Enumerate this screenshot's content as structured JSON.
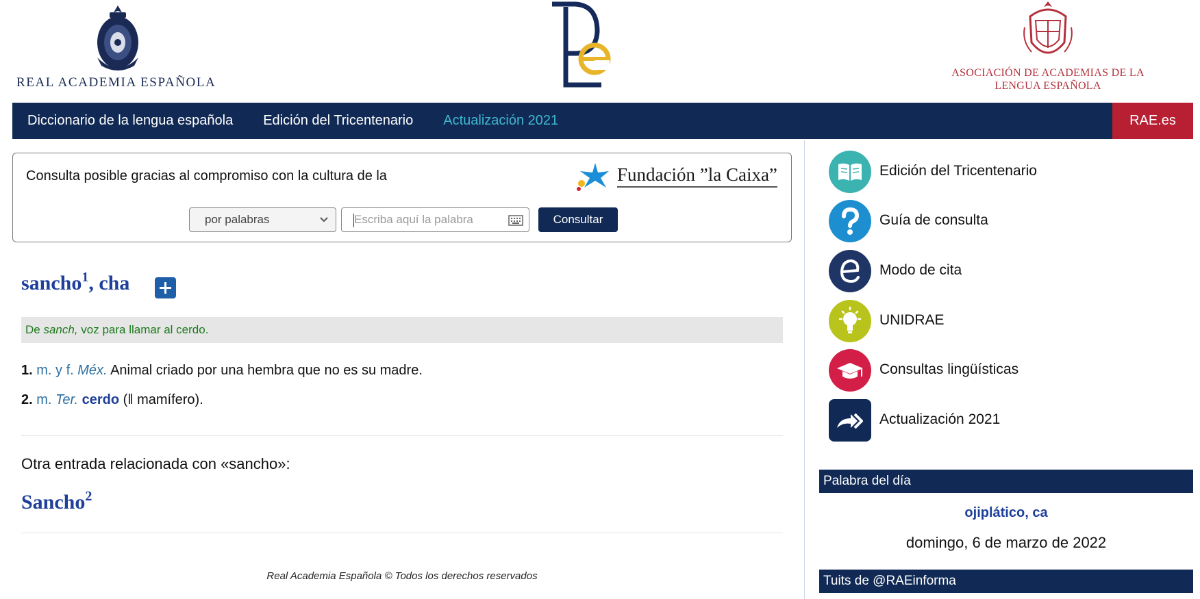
{
  "header": {
    "rae_name": "REAL ACADEMIA ESPAÑOLA",
    "asale_name_line1": "ASOCIACIÓN DE ACADEMIAS DE LA",
    "asale_name_line2": "LENGUA ESPAÑOLA"
  },
  "nav": {
    "items": [
      {
        "label": "Diccionario de la lengua española"
      },
      {
        "label": "Edición del Tricentenario"
      },
      {
        "label": "Actualización 2021"
      }
    ],
    "rae_link": "RAE.es"
  },
  "search": {
    "sponsor_text": "Consulta posible gracias al compromiso con la cultura de la",
    "sponsor_name": "Fundación ”la Caixa”",
    "mode": "por palabras",
    "placeholder": "Escriba aquí la palabra",
    "button": "Consultar"
  },
  "entry": {
    "headword": "sancho",
    "headword_sup": "1",
    "headword_rest": ", cha",
    "etym_pre": "De ",
    "etym_word": "sanch,",
    "etym_post": " voz para llamar al cerdo.",
    "defs": [
      {
        "num": "1.",
        "abbr1": "m. y f.",
        "abbr2": "Méx.",
        "text": " Animal criado por una hembra que no es su madre."
      },
      {
        "num": "2.",
        "abbr1": "m.",
        "abbr2": "Ter.",
        "ref": "cerdo",
        "text": " (‖ mamífero)."
      }
    ]
  },
  "related": {
    "label": "Otra entrada relacionada con «sancho»:",
    "word": "Sancho",
    "sup": "2"
  },
  "footer": "Real Academia Española © Todos los derechos reservados",
  "sidebar": {
    "links": [
      {
        "label": "Edición del Tricentenario",
        "icon": "book-icon",
        "color": "#3bb3b0"
      },
      {
        "label": "Guía de consulta",
        "icon": "question-icon",
        "color": "#1d8fd0"
      },
      {
        "label": "Modo de cita",
        "icon": "e-letter-icon",
        "color": "#1f3566"
      },
      {
        "label": "UNIDRAE",
        "icon": "lightbulb-icon",
        "color": "#b8c41c"
      },
      {
        "label": "Consultas lingüísticas",
        "icon": "graduation-cap-icon",
        "color": "#d31f47"
      },
      {
        "label": "Actualización 2021",
        "icon": "forward-arrows-icon",
        "color": "#112a55"
      }
    ],
    "word_of_day_title": "Palabra del día",
    "word_of_day": "ojiplático, ca",
    "word_of_day_date": "domingo, 6 de marzo de 2022",
    "tweets_title": "Tuits de @RAEinforma"
  }
}
